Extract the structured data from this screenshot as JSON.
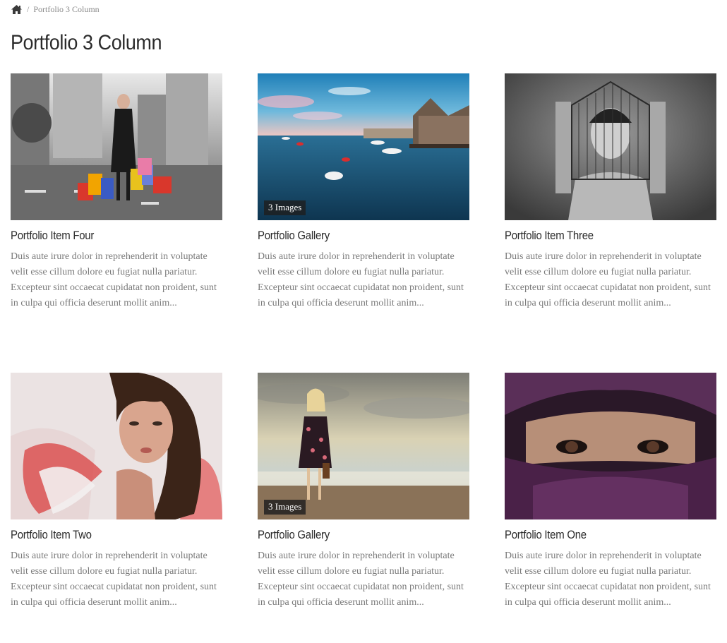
{
  "breadcrumb": {
    "home_icon": "home-icon",
    "separator": "/",
    "current": "Portfolio 3 Column"
  },
  "page_title": "Portfolio 3 Column",
  "items": [
    {
      "title": "Portfolio Item Four",
      "desc": "Duis aute irure dolor in reprehenderit in voluptate velit esse cillum dolore eu fugiat nulla pariatur. Excepteur sint occaecat cupidatat non proident, sunt in culpa qui officia deserunt mollit anim...",
      "badge": "",
      "image": "woman-shopping-bags-city-street"
    },
    {
      "title": "Portfolio Gallery",
      "desc": "Duis aute irure dolor in reprehenderit in voluptate velit esse cillum dolore eu fugiat nulla pariatur. Excepteur sint occaecat cupidatat non proident, sunt in culpa qui officia deserunt mollit anim...",
      "badge": "3 Images",
      "image": "harbor-boats-sunset"
    },
    {
      "title": "Portfolio Item Three",
      "desc": "Duis aute irure dolor in reprehenderit in voluptate velit esse cillum dolore eu fugiat nulla pariatur. Excepteur sint occaecat cupidatat non proident, sunt in culpa qui officia deserunt mollit anim...",
      "badge": "",
      "image": "woman-birdcage-head"
    },
    {
      "title": "Portfolio Item Two",
      "desc": "Duis aute irure dolor in reprehenderit in voluptate velit esse cillum dolore eu fugiat nulla pariatur. Excepteur sint occaecat cupidatat non proident, sunt in culpa qui officia deserunt mollit anim...",
      "badge": "",
      "image": "woman-red-ruffle-collar"
    },
    {
      "title": "Portfolio Gallery",
      "desc": "Duis aute irure dolor in reprehenderit in voluptate velit esse cillum dolore eu fugiat nulla pariatur. Excepteur sint occaecat cupidatat non proident, sunt in culpa qui officia deserunt mollit anim...",
      "badge": "3 Images",
      "image": "woman-dress-beach"
    },
    {
      "title": "Portfolio Item One",
      "desc": "Duis aute irure dolor in reprehenderit in voluptate velit esse cillum dolore eu fugiat nulla pariatur. Excepteur sint occaecat cupidatat non proident, sunt in culpa qui officia deserunt mollit anim...",
      "badge": "",
      "image": "woman-purple-veil-eyes"
    }
  ],
  "colors": {
    "title": "#2b2b2b",
    "text": "#7a7a7a",
    "breadcrumb": "#8a8a8a",
    "badge_bg": "#1e1e1e"
  }
}
